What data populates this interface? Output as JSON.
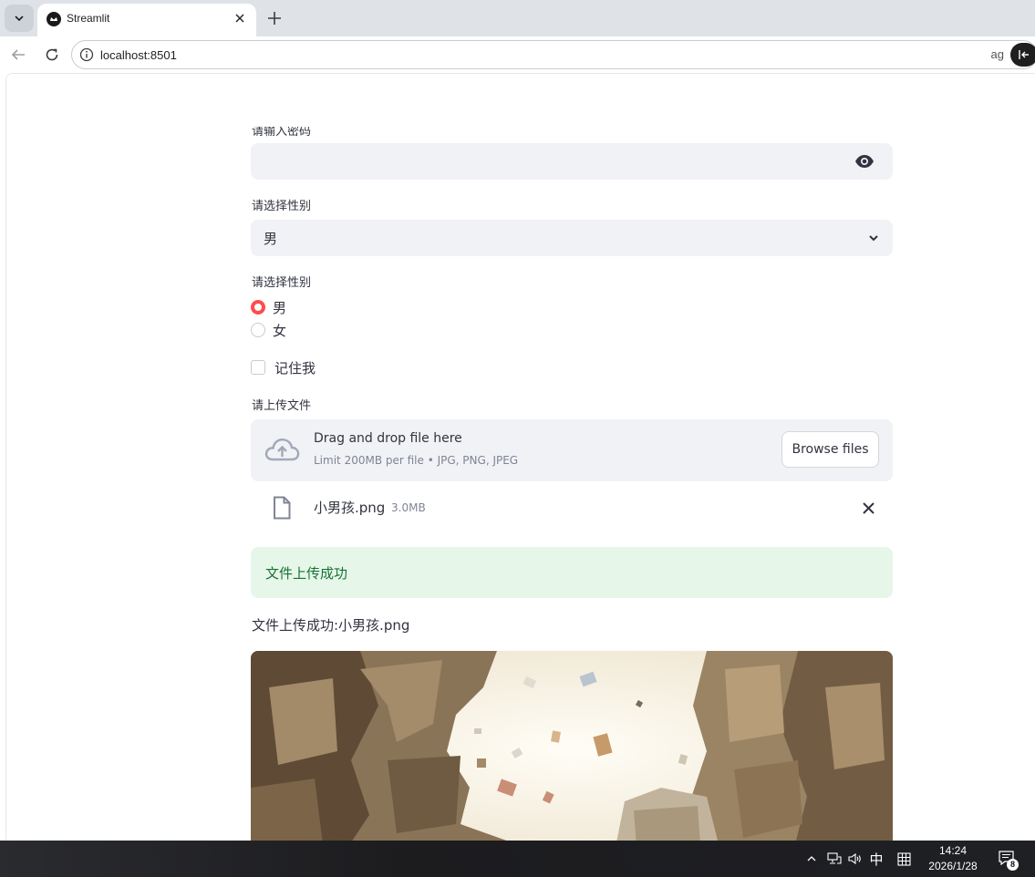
{
  "browser": {
    "tab_title": "Streamlit",
    "url": "localhost:8501",
    "omnibox_trailing": "ag"
  },
  "form": {
    "password_label": "请输入密码",
    "gender_select_label": "请选择性别",
    "gender_select_value": "男",
    "gender_radio_label": "请选择性别",
    "gender_options": [
      "男",
      "女"
    ],
    "gender_selected": "男",
    "remember_label": "记住我",
    "upload_label": "请上传文件"
  },
  "uploader": {
    "title": "Drag and drop file here",
    "subtitle": "Limit 200MB per file • JPG, PNG, JPEG",
    "browse_label": "Browse files",
    "file_name": "小男孩.png",
    "file_size": "3.0MB"
  },
  "result": {
    "alert_text": "文件上传成功",
    "message": "文件上传成功:小男孩.png"
  },
  "taskbar": {
    "ime_label": "中",
    "time": "14:24",
    "date": "2026/1/28",
    "notification_count": "8"
  },
  "colors": {
    "accent": "#ff4b4b",
    "success_bg": "#e6f7ea",
    "success_text": "#177233",
    "input_bg": "#f0f2f6"
  }
}
